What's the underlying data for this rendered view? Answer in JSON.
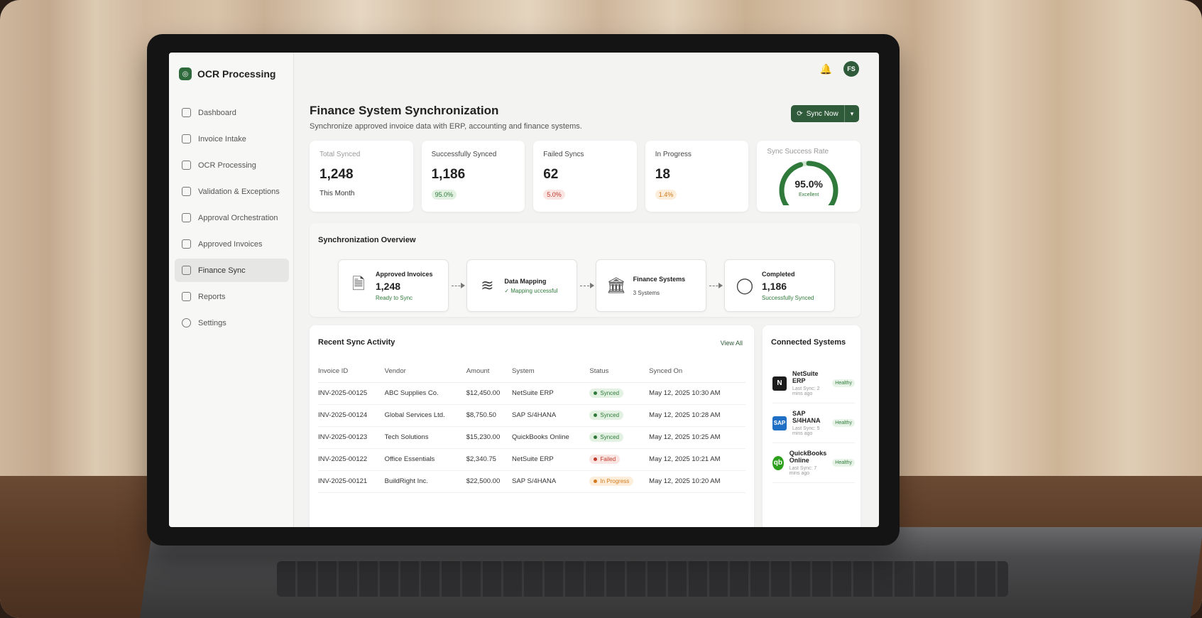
{
  "app": {
    "name": "OCR Processing",
    "user_initials": "FS"
  },
  "sidebar": {
    "items": [
      {
        "label": "Dashboard",
        "icon": "home-icon"
      },
      {
        "label": "Invoice Intake",
        "icon": "document-icon"
      },
      {
        "label": "OCR Processing",
        "icon": "scan-icon"
      },
      {
        "label": "Validation & Exceptions",
        "icon": "shield-icon"
      },
      {
        "label": "Approval Orchestration",
        "icon": "approval-icon"
      },
      {
        "label": "Approved Invoices",
        "icon": "clipboard-icon"
      },
      {
        "label": "Finance Sync",
        "icon": "sync-icon",
        "active": true
      },
      {
        "label": "Reports",
        "icon": "chart-icon"
      },
      {
        "label": "Settings",
        "icon": "gear-icon"
      }
    ]
  },
  "header": {
    "title": "Finance System Synchronization",
    "subtitle": "Synchronize approved invoice data with ERP, accounting and finance systems.",
    "sync_button": "Sync Now"
  },
  "stats": {
    "total": {
      "label": "Total Synced",
      "value": "1,248",
      "foot": "This Month"
    },
    "success": {
      "label": "Successfully Synced",
      "value": "1,186",
      "badge": "95.0%"
    },
    "failed": {
      "label": "Failed Syncs",
      "value": "62",
      "badge": "5.0%"
    },
    "progress": {
      "label": "In Progress",
      "value": "18",
      "badge": "1.4%"
    },
    "rate": {
      "label": "Sync Success Rate",
      "value": "95.0%",
      "caption": "Excellent",
      "fraction": 0.95
    }
  },
  "overview": {
    "title": "Synchronization Overview",
    "steps": [
      {
        "title": "Approved Invoices",
        "value": "1,248",
        "note": "Ready to Sync"
      },
      {
        "title": "Data Mapping",
        "value": "",
        "note": "✓ Mapping uccessful"
      },
      {
        "title": "Finance Systems",
        "value": "",
        "note": "3 Systems"
      },
      {
        "title": "Completed",
        "value": "1,186",
        "note": "Successfully Synced"
      }
    ]
  },
  "activity": {
    "title": "Recent Sync Activity",
    "view_all": "View All",
    "columns": [
      "Invoice ID",
      "Vendor",
      "Amount",
      "System",
      "Status",
      "Synced On"
    ],
    "rows": [
      [
        "INV-2025-00125",
        "ABC Supplies Co.",
        "$12,450.00",
        "NetSuite ERP",
        "Synced",
        "May 12, 2025 10:30 AM"
      ],
      [
        "INV-2025-00124",
        "Global Services Ltd.",
        "$8,750.50",
        "SAP S/4HANA",
        "Synced",
        "May 12, 2025 10:28 AM"
      ],
      [
        "INV-2025-00123",
        "Tech Solutions",
        "$15,230.00",
        "QuickBooks Online",
        "Synced",
        "May 12, 2025 10:25 AM"
      ],
      [
        "INV-2025-00122",
        "Office Essentials",
        "$2,340.75",
        "NetSuite ERP",
        "Failed",
        "May 12, 2025 10:21 AM"
      ],
      [
        "INV-2025-00121",
        "BuildRight Inc.",
        "$22,500.00",
        "SAP S/4HANA",
        "In Progress",
        "May 12, 2025 10:20 AM"
      ]
    ]
  },
  "connected": {
    "title": "Connected Systems",
    "systems": [
      {
        "name": "NetSuite ERP",
        "last": "Last Sync: 2 mins ago",
        "health": "Healthy"
      },
      {
        "name": "SAP S/4HANA",
        "last": "Last Sync: 5 mins ago",
        "health": "Healthy"
      },
      {
        "name": "QuickBooks Online",
        "last": "Last Sync: 7 mins ago",
        "health": "Healthy"
      }
    ]
  },
  "colors": {
    "accent": "#2f5b3a",
    "success": "#2f7a3a",
    "danger": "#c0392b",
    "warning": "#d27a1e"
  }
}
